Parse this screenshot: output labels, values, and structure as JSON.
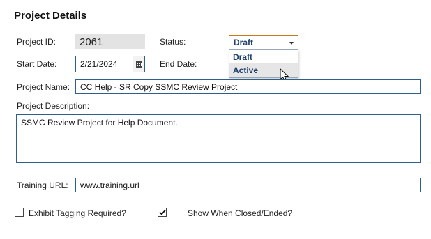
{
  "title": "Project Details",
  "fields": {
    "project_id": {
      "label": "Project ID:",
      "value": "2061"
    },
    "status": {
      "label": "Status:",
      "value": "Draft",
      "options": [
        "Draft",
        "Active"
      ],
      "hovered_option": "Active"
    },
    "start_date": {
      "label": "Start Date:",
      "value": "2/21/2024"
    },
    "end_date": {
      "label": "End Date:",
      "value": ""
    },
    "project_name": {
      "label": "Project Name:",
      "value": "CC Help - SR Copy SSMC Review Project"
    },
    "project_description": {
      "label": "Project Description:",
      "value": "SSMC Review Project for Help Document."
    },
    "training_url": {
      "label": "Training URL:",
      "value": "www.training.url"
    }
  },
  "checkboxes": {
    "exhibit_tagging": {
      "label": "Exhibit Tagging Required?",
      "checked": false
    },
    "show_when_closed": {
      "label": "Show When Closed/Ended?",
      "checked": true
    }
  },
  "colors": {
    "field_border": "#2d5f8b",
    "select_border_focus": "#c77a19",
    "option_text": "#1d3f6e",
    "readonly_bg": "#e3e3e3"
  }
}
